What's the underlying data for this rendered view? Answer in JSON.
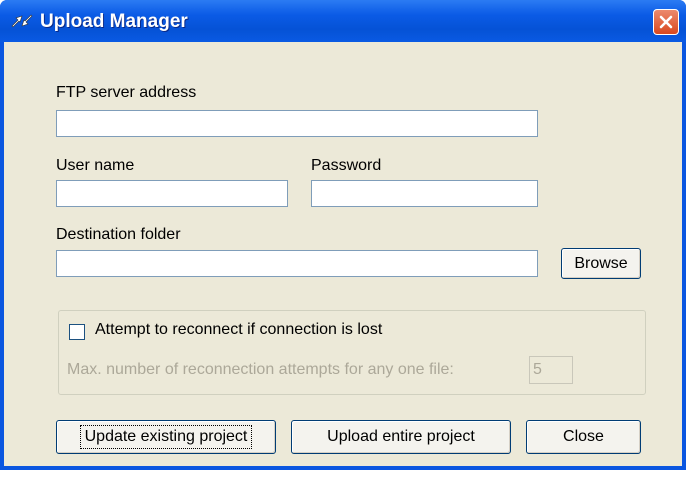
{
  "window": {
    "title": "Upload Manager",
    "icon": "upload-arrows-icon"
  },
  "form": {
    "ftp_label": "FTP server address",
    "ftp_value": "",
    "user_label": "User name",
    "user_value": "",
    "password_label": "Password",
    "password_value": "",
    "dest_label": "Destination folder",
    "dest_value": "",
    "browse_label": "Browse"
  },
  "reconnect": {
    "checkbox_label": "Attempt to reconnect if connection is lost",
    "checked": false,
    "max_label": "Max. number of reconnection attempts for any one file:",
    "max_value": "5"
  },
  "buttons": {
    "update": "Update existing project",
    "upload": "Upload entire project",
    "close": "Close"
  },
  "colors": {
    "titlebar": "#0552d6",
    "client": "#ece9d8",
    "close_button": "#d9481f"
  }
}
